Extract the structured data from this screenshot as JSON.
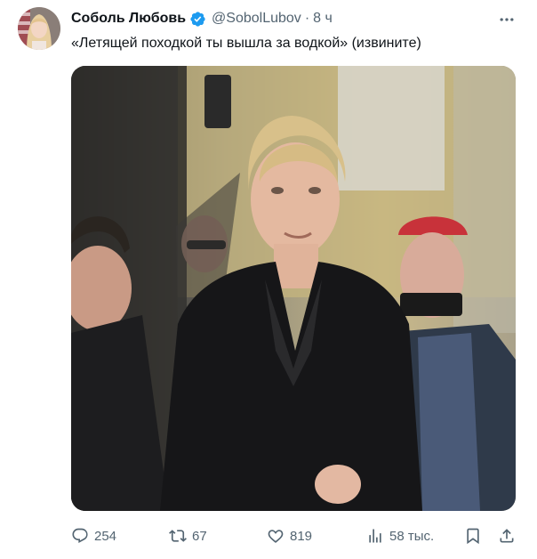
{
  "author": {
    "display_name": "Соболь Любовь",
    "handle": "@SobolLubov",
    "separator": "·",
    "time": "8 ч",
    "verified": true
  },
  "tweet": {
    "text": "«Летящей походкой ты вышла за водкой» (извините)"
  },
  "metrics": {
    "replies": "254",
    "reposts": "67",
    "likes": "819",
    "views": "58 тыс."
  },
  "icons": {
    "verified": "verified-badge-icon",
    "more": "more-options-icon",
    "reply": "reply-icon",
    "repost": "repost-icon",
    "like": "heart-icon",
    "views": "views-chart-icon",
    "bookmark": "bookmark-icon",
    "share": "share-icon"
  },
  "colors": {
    "verified": "#1d9bf0",
    "text": "#0f1419",
    "muted": "#536471"
  }
}
